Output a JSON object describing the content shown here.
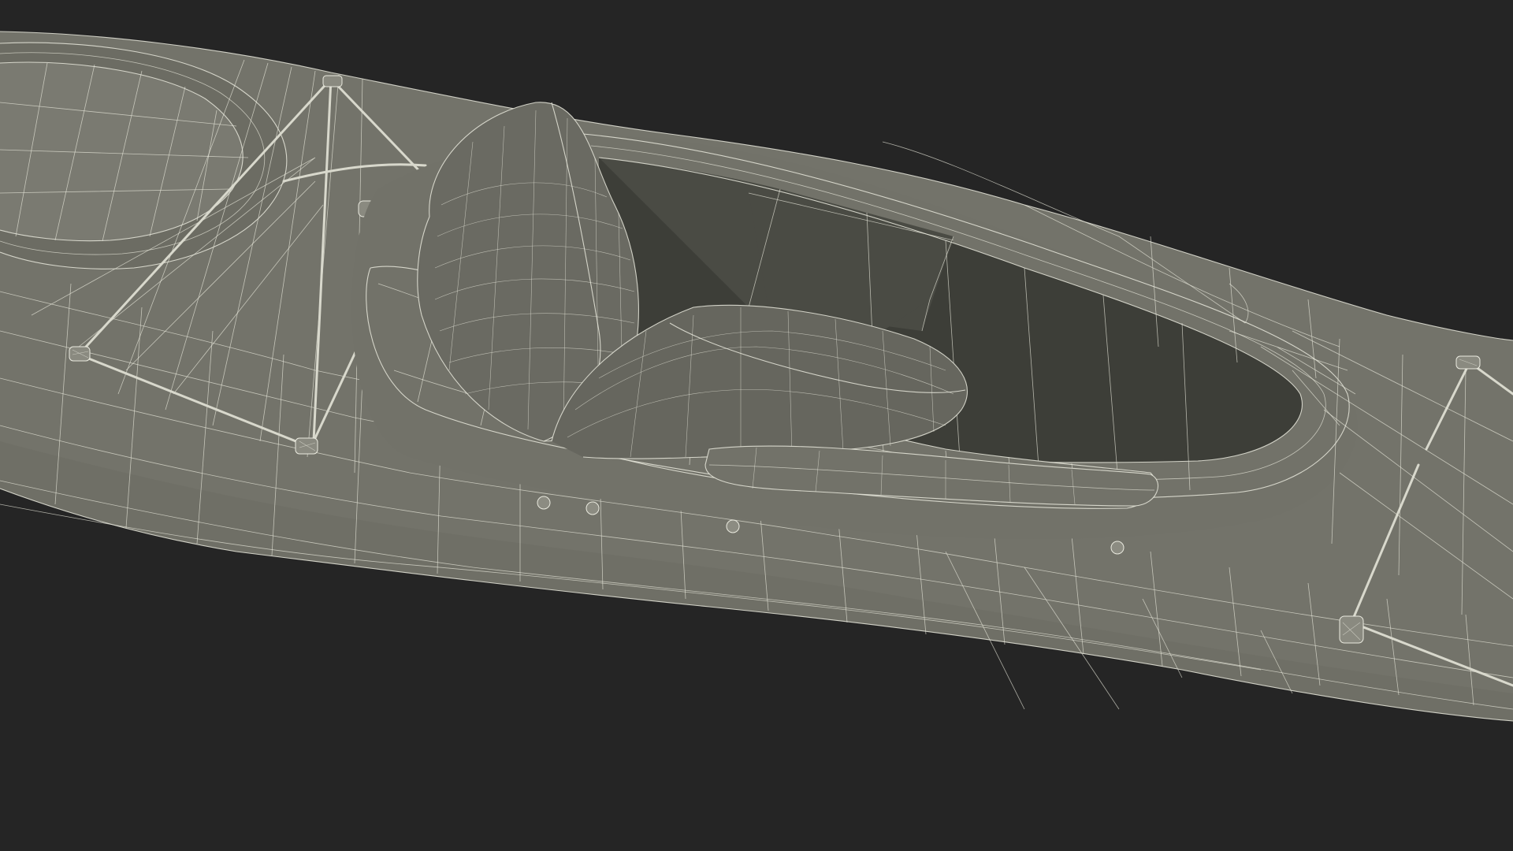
{
  "scene": {
    "subject": "kayak-wireframe",
    "colors": {
      "background": "#252525",
      "hull": "#73736a",
      "cockpit_interior": "#3d3e38",
      "wireframe": "#e8e8dc"
    },
    "icons": [
      "kayak-hull",
      "front-hatch",
      "cockpit",
      "seat",
      "deck-bungee",
      "carry-handle"
    ]
  }
}
